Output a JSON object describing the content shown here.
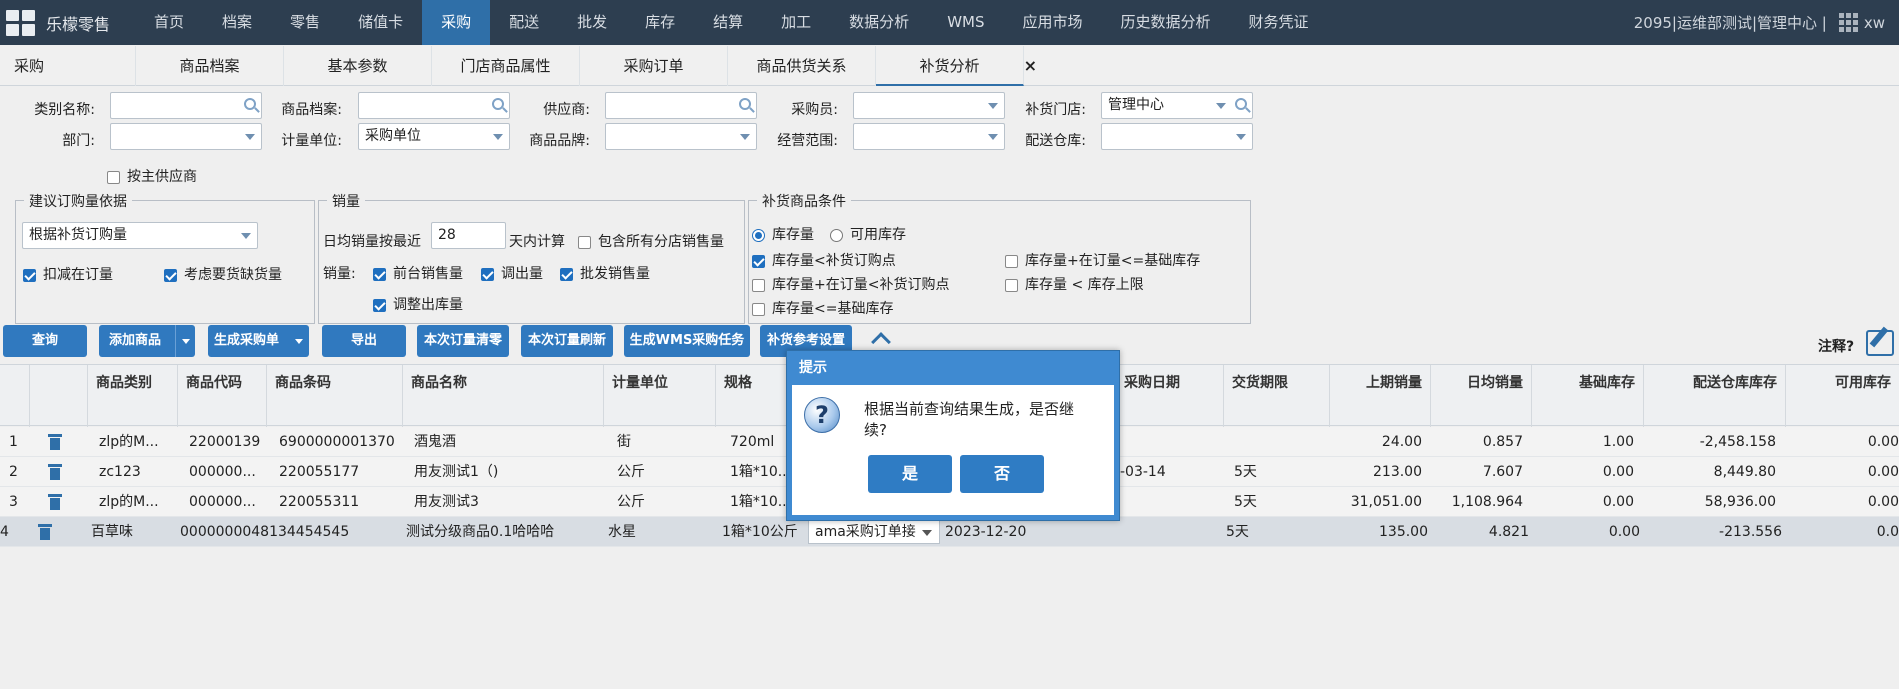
{
  "topnav": {
    "brand": "乐檬零售",
    "items": [
      "首页",
      "档案",
      "零售",
      "储值卡",
      "采购",
      "配送",
      "批发",
      "库存",
      "结算",
      "加工",
      "数据分析",
      "WMS",
      "应用市场",
      "历史数据分析",
      "财务凭证"
    ],
    "active_index": 4,
    "account": "2095|运维部测试|管理中心 |",
    "user": "xw"
  },
  "tabs": {
    "items": [
      "采购",
      "商品档案",
      "基本参数",
      "门店商品属性",
      "采购订单",
      "商品供货关系",
      "补货分析"
    ],
    "active_index": 6,
    "close": "×"
  },
  "filters": {
    "category_label": "类别名称:",
    "category_value": "",
    "product_label": "商品档案:",
    "product_value": "",
    "supplier_label": "供应商:",
    "supplier_value": "",
    "buyer_label": "采购员:",
    "buyer_value": "",
    "store_label": "补货门店:",
    "store_value": "管理中心",
    "dept_label": "部门:",
    "dept_value": "",
    "unit_label": "计量单位:",
    "unit_value": "采购单位",
    "brand_label": "商品品牌:",
    "brand_value": "",
    "scope_label": "经营范围:",
    "scope_value": "",
    "warehouse_label": "配送仓库:",
    "warehouse_value": "",
    "main_supplier_label": "按主供应商",
    "main_supplier_checked": false
  },
  "suggest": {
    "title": "建议订购量依据",
    "basis_value": "根据补货订购量",
    "deduct_onorder": "扣减在订量",
    "consider_shortage": "考虑要货缺货量"
  },
  "sales": {
    "title": "销量",
    "avg_label": "日均销量按最近",
    "days_value": "28",
    "days_suffix": "天内计算",
    "include_all": "包含所有分店销售量",
    "sales_label": "销量:",
    "pos_sales": "前台销售量",
    "transfer_out": "调出量",
    "wholesale_sales": "批发销售量",
    "adjust_out": "调整出库量"
  },
  "conditions": {
    "title": "补货商品条件",
    "stock_qty": "库存量",
    "avail_stock": "可用库存",
    "c1": "库存量<补货订购点",
    "c2": "库存量+在订量<=基础库存",
    "c3": "库存量+在订量<补货订购点",
    "c4": "库存量 < 库存上限",
    "c5": "库存量<=基础库存"
  },
  "buttons": {
    "query": "查询",
    "add_product": "添加商品",
    "gen_po": "生成采购单",
    "export": "导出",
    "clear_order": "本次订量清零",
    "refresh_order": "本次订量刷新",
    "gen_wms": "生成WMS采购任务",
    "ref_settings": "补货参考设置",
    "note_label": "注释?"
  },
  "table": {
    "headers": [
      "商品类别",
      "商品代码",
      "商品条码",
      "商品名称",
      "计量单位",
      "规格",
      "采购日期",
      "交货期限",
      "上期销量",
      "日均销量",
      "基础库存",
      "配送仓库库存",
      "可用库存"
    ],
    "rows": [
      {
        "no": "1",
        "category": "zlp的M...",
        "code": "22000139",
        "barcode": "6900000001370",
        "name": "酒鬼酒",
        "unit": "街",
        "spec": "720ml",
        "order_unit": "",
        "date": "",
        "term": "",
        "last_sales": "24.00",
        "avg_sales": "0.857",
        "base_stock": "1.00",
        "wh_stock": "-2,458.158",
        "avail": "0.00"
      },
      {
        "no": "2",
        "category": "zc123",
        "code": "000000...",
        "barcode": "220055177",
        "name": "用友测试1（)",
        "unit": "公斤",
        "spec": "1箱*10...",
        "order_unit": "",
        "date": "-03-14",
        "term": "5天",
        "last_sales": "213.00",
        "avg_sales": "7.607",
        "base_stock": "0.00",
        "wh_stock": "8,449.80",
        "avail": "0.00"
      },
      {
        "no": "3",
        "category": "zlp的M...",
        "code": "000000...",
        "barcode": "220055311",
        "name": "用友测试3",
        "unit": "公斤",
        "spec": "1箱*10...",
        "order_unit": "",
        "date": "",
        "term": "5天",
        "last_sales": "31,051.00",
        "avg_sales": "1,108.964",
        "base_stock": "0.00",
        "wh_stock": "58,936.00",
        "avail": "0.00"
      },
      {
        "no": "4",
        "category": "百草味",
        "code": "",
        "barcode": "0000000048134454545",
        "name": "测试分级商品0.1哈哈哈",
        "unit": "水星",
        "spec": "1箱*10公斤",
        "order_unit": "ama采购订单接",
        "date": "2023-12-20",
        "term": "5天",
        "last_sales": "135.00",
        "avg_sales": "4.821",
        "base_stock": "0.00",
        "wh_stock": "-213.556",
        "avail": "0.0"
      }
    ]
  },
  "dialog": {
    "title": "提示",
    "message": "根据当前查询结果生成，是否继续?",
    "yes": "是",
    "no": "否"
  }
}
